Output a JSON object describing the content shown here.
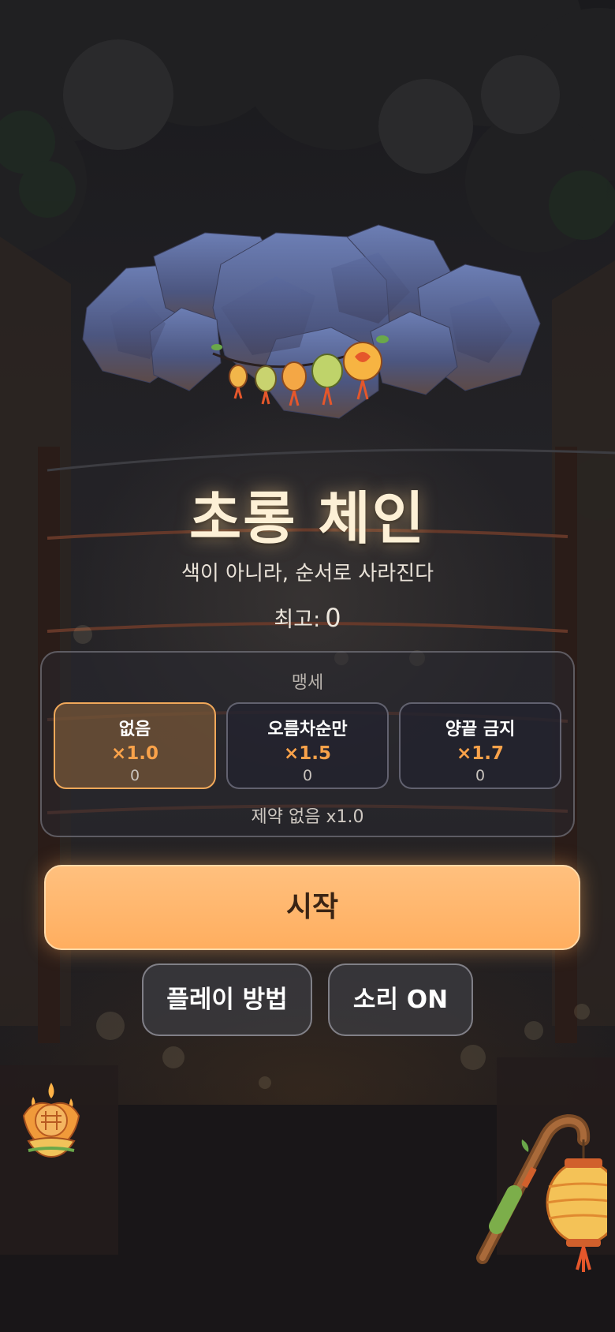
{
  "title": "초롱 체인",
  "subtitle": "색이 아니라, 순서로 사라진다",
  "best": {
    "label": "최고:",
    "value": "0"
  },
  "oath": {
    "title": "맹세",
    "options": [
      {
        "name": "없음",
        "multiplier": "×1.0",
        "score": "0",
        "selected": true
      },
      {
        "name": "오름차순만",
        "multiplier": "×1.5",
        "score": "0",
        "selected": false
      },
      {
        "name": "양끝 금지",
        "multiplier": "×1.7",
        "score": "0",
        "selected": false
      }
    ],
    "description": "제약 없음 x1.0"
  },
  "buttons": {
    "start": "시작",
    "how_to_play": "플레이 방법",
    "sound": "소리 ON"
  },
  "colors": {
    "accent": "#ffb56b",
    "multiplier": "#f9a24a",
    "selected_border": "#f0a85a",
    "title": "#fdf0d6"
  },
  "icons": {
    "hero": "cloud-with-lanterns-icon",
    "lotus": "lotus-lantern-icon",
    "staff": "lantern-staff-icon"
  }
}
